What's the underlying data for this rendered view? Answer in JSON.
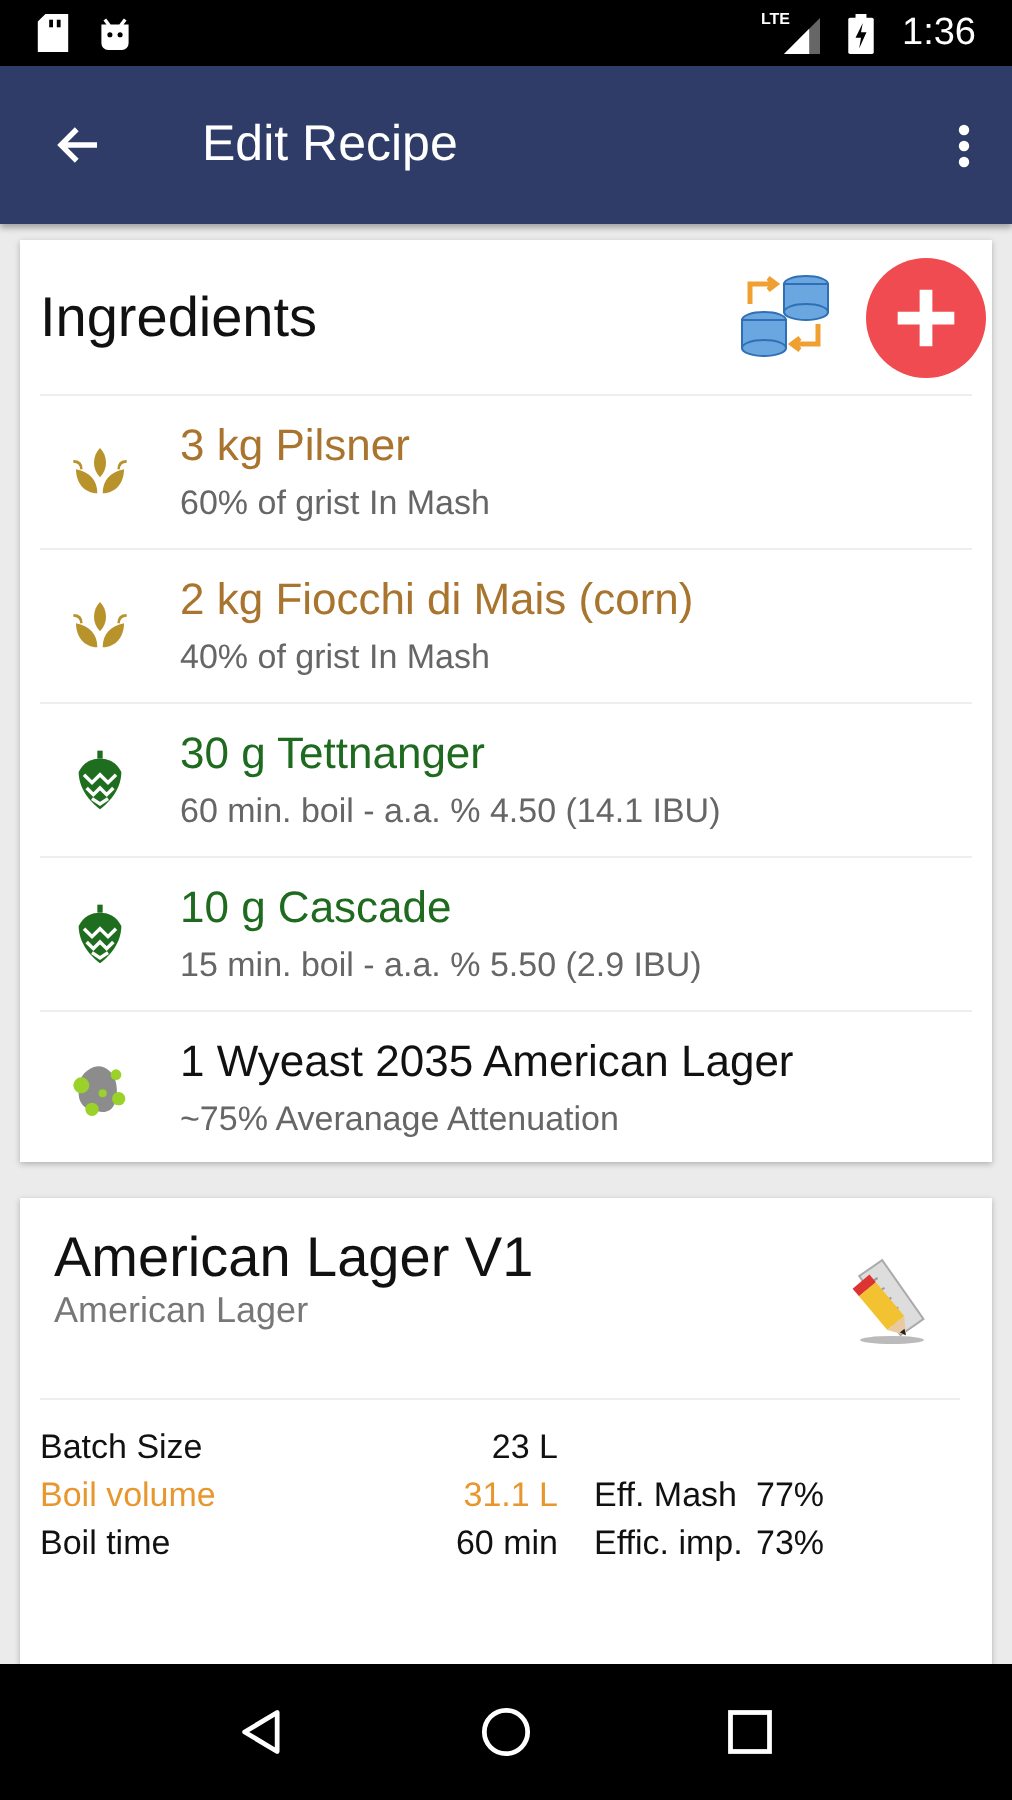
{
  "status_bar": {
    "network": "LTE",
    "time": "1:36"
  },
  "app_bar": {
    "title": "Edit Recipe"
  },
  "ingredients": {
    "title": "Ingredients",
    "items": [
      {
        "kind": "grain",
        "name": "3 kg Pilsner",
        "detail": "60% of grist In Mash"
      },
      {
        "kind": "grain",
        "name": "2 kg Fiocchi di Mais (corn)",
        "detail": "40% of grist In Mash"
      },
      {
        "kind": "hop",
        "name": "30 g Tettnanger",
        "detail": "60 min. boil - a.a. % 4.50 (14.1 IBU)"
      },
      {
        "kind": "hop",
        "name": "10 g Cascade",
        "detail": "15 min. boil - a.a. % 5.50 (2.9 IBU)"
      },
      {
        "kind": "yeast",
        "name": "1 Wyeast 2035 American Lager",
        "detail": "~75% Averanage Attenuation"
      }
    ]
  },
  "recipe": {
    "name": "American Lager V1",
    "style": "American Lager",
    "stats": [
      {
        "label": "Batch Size",
        "value": "23 L",
        "highlighted": false
      },
      {
        "label": "Boil volume",
        "value": "31.1 L",
        "highlighted": true,
        "label_2": "Eff. Mash",
        "value_2": "77%"
      },
      {
        "label": "Boil time",
        "value": "60 min",
        "highlighted": false,
        "label_2": "Effic. imp.",
        "value_2": "73%"
      }
    ]
  }
}
